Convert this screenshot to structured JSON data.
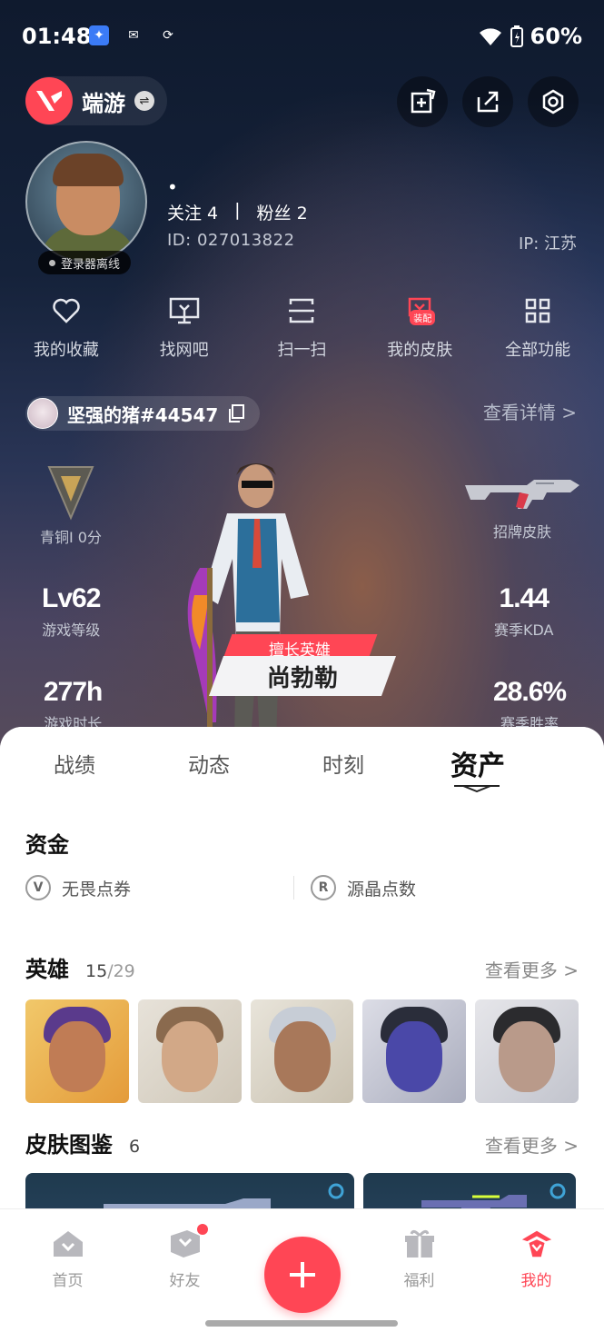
{
  "status_bar": {
    "time": "01:48",
    "battery": "60%"
  },
  "app": {
    "name": "端游"
  },
  "profile": {
    "dot": "•",
    "following": "关注 4",
    "separator": "|",
    "followers": "粉丝 2",
    "id": "ID: 027013822",
    "ip": "IP: 江苏",
    "offline_badge": "登录器离线"
  },
  "quick_menu": [
    {
      "label": "我的收藏",
      "icon": "heart-icon"
    },
    {
      "label": "找网吧",
      "icon": "monitor-icon"
    },
    {
      "label": "扫一扫",
      "icon": "scan-icon"
    },
    {
      "label": "我的皮肤",
      "icon": "skin-icon",
      "badge": "装配"
    },
    {
      "label": "全部功能",
      "icon": "grid-icon"
    }
  ],
  "account": {
    "name": "坚强的猪#44547",
    "view_detail": "查看详情 >"
  },
  "stats": {
    "rank": "青铜I 0分",
    "signature_skin": "招牌皮肤",
    "level_value": "Lv62",
    "level_label": "游戏等级",
    "kda_value": "1.44",
    "kda_label": "赛季KDA",
    "hours_value": "277h",
    "hours_label": "游戏时长",
    "winrate_value": "28.6%",
    "winrate_label": "赛季胜率"
  },
  "featured_hero": {
    "tag": "擅长英雄",
    "name": "尚勃勒"
  },
  "tabs": [
    "战绩",
    "动态",
    "时刻",
    "资产"
  ],
  "active_tab": "资产",
  "funds": {
    "title": "资金",
    "items": [
      {
        "label": "无畏点券",
        "icon": "valorant-points-icon"
      },
      {
        "label": "源晶点数",
        "icon": "radianite-icon"
      }
    ]
  },
  "heroes": {
    "title": "英雄",
    "owned": "15",
    "separator": "/",
    "total": "29",
    "see_more": "查看更多 >"
  },
  "skins": {
    "title": "皮肤图鉴",
    "count": "6",
    "see_more": "查看更多 >"
  },
  "bottom_nav": [
    {
      "label": "首页",
      "icon": "home-icon"
    },
    {
      "label": "好友",
      "icon": "friends-icon"
    },
    {
      "label": "",
      "icon": "plus-icon"
    },
    {
      "label": "福利",
      "icon": "gift-icon"
    },
    {
      "label": "我的",
      "icon": "profile-icon"
    }
  ],
  "colors": {
    "accent": "#ff4655",
    "hero_bg": "#15223a"
  }
}
